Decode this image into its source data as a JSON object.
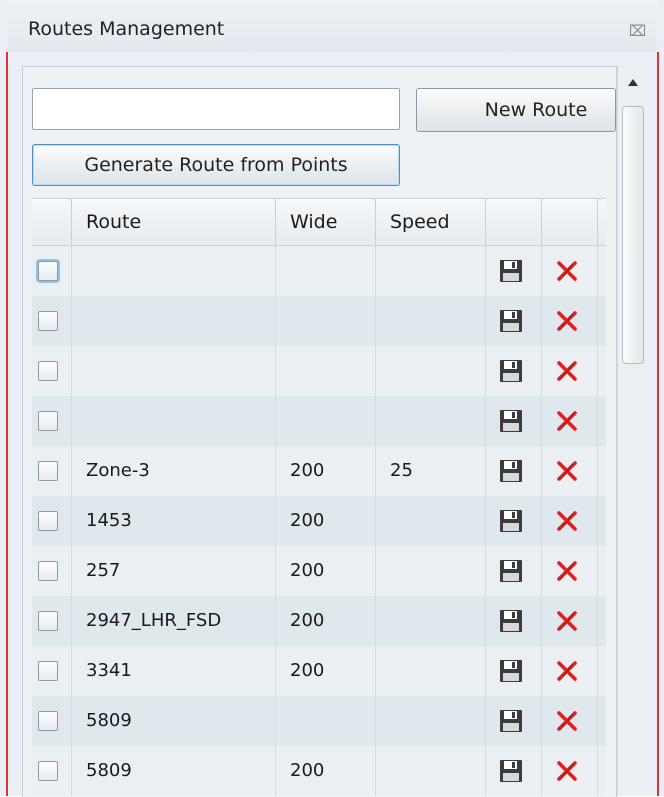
{
  "window": {
    "title": "Routes Management",
    "close_symbol": "⌧"
  },
  "toolbar": {
    "new_route_label": "New Route",
    "generate_label": "Generate Route from Points",
    "route_input_value": ""
  },
  "grid": {
    "headers": {
      "route": "Route",
      "wide": "Wide",
      "speed": "Speed"
    },
    "rows": [
      {
        "route": "",
        "wide": "",
        "speed": ""
      },
      {
        "route": "",
        "wide": "",
        "speed": ""
      },
      {
        "route": "",
        "wide": "",
        "speed": ""
      },
      {
        "route": "",
        "wide": "",
        "speed": ""
      },
      {
        "route": " Zone-3",
        "wide": "200",
        "speed": "25"
      },
      {
        "route": "1453",
        "wide": "200",
        "speed": ""
      },
      {
        "route": "257",
        "wide": "200",
        "speed": ""
      },
      {
        "route": "2947_LHR_FSD",
        "wide": "200",
        "speed": ""
      },
      {
        "route": "3341",
        "wide": "200",
        "speed": ""
      },
      {
        "route": "5809",
        "wide": "",
        "speed": ""
      },
      {
        "route": "5809",
        "wide": "200",
        "speed": ""
      }
    ]
  },
  "colors": {
    "accent_focus": "#4b91c6",
    "delete_red": "#e02020",
    "window_border": "#e03434"
  },
  "icons": {
    "save": "floppy-disk-icon",
    "delete": "red-x-icon",
    "close": "close-icon",
    "scroll_up": "triangle-up-icon"
  }
}
